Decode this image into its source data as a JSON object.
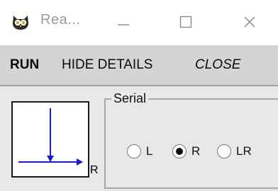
{
  "window": {
    "title": "Rea...",
    "icon": "owl-icon",
    "controls": [
      "minimize-icon",
      "maximize-icon",
      "close-icon"
    ]
  },
  "menu": {
    "run": "RUN",
    "hide_details": "HIDE DETAILS",
    "close": "CLOSE"
  },
  "diagram": {
    "label": "R",
    "line_color": "#1a1acc"
  },
  "serial": {
    "legend": "Serial",
    "options": [
      {
        "label": "L",
        "selected": false
      },
      {
        "label": "R",
        "selected": true
      },
      {
        "label": "LR",
        "selected": false
      }
    ]
  }
}
